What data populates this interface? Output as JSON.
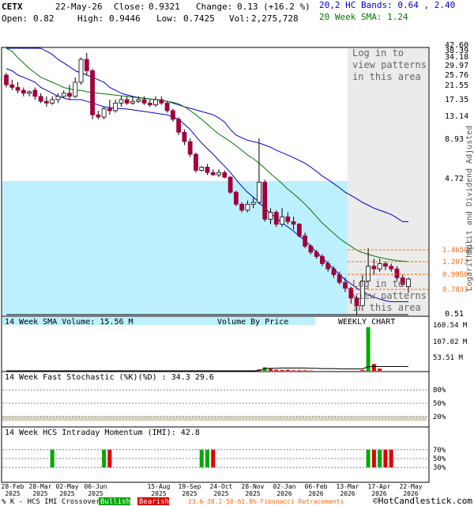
{
  "header": {
    "ticker": "CETX",
    "date": "22-May-26",
    "close_label": "Close:",
    "close": "0.9321",
    "change_label": "Change:",
    "change": "0.13 (+16.2 %)",
    "open_label": "Open:",
    "open": "0.82",
    "high_label": "High:",
    "high": "0.9446",
    "low_label": "Low:",
    "low": "0.7425",
    "vol_label": "Vol:",
    "vol": "2,275,728",
    "hc_bands": "20,2 HC Bands: 0.64 , 2.40",
    "sma_label": "20 Week SMA: 1.24"
  },
  "side_labels": {
    "split": "Split and Dividend Adjusted",
    "log": "Logarithmic"
  },
  "overlays": {
    "login_top": [
      "Log in to",
      "view patterns",
      "in this area"
    ],
    "login_bottom": [
      "Log in to",
      "view patterns",
      "in this area"
    ]
  },
  "panel_titles": {
    "volume": "14 Week SMA Volume: 15.56 M",
    "vbp": "Volume By Price",
    "weekly": "WEEKLY CHART",
    "stoch": "14 Week Fast Stochastic (%K)(%D) : 34.3  29.6",
    "imi": "14 Week HCS Intraday Momentum (IMI): 42.8"
  },
  "footer": {
    "legend_prefix": "% K - HCS IMI Crossover:",
    "bullish": "Bullish",
    "bearish": "Bearish",
    "fib": "23.6-38.2-50-61.8% Fibonacci Retracements",
    "credit": "©HotCandlestick.com"
  },
  "colors": {
    "up": "#ffffff",
    "down": "#a0003c",
    "bands": "#0000cc",
    "sma": "#007700",
    "vbp": "#bdf0ff",
    "login_bg": "#e8e8e8",
    "fib": "#ff6600",
    "vol_bar": "#dd0000",
    "vol_bull": "#00aa00",
    "stoch_k": "#aa0000",
    "stoch_d": "#000000",
    "bull": "#00aa00",
    "bear": "#dd0000",
    "axis_text": "#000080"
  },
  "chart_data": {
    "type": "candlestick",
    "scale": "log",
    "ylim": [
      0.51,
      42.6
    ],
    "price_ticks": [
      "42.60",
      "38.39",
      "34.18",
      "29.97",
      "25.76",
      "21.55",
      "17.35",
      "13.14",
      "8.93",
      "4.72",
      "0.51"
    ],
    "fib_levels": [
      "1.4650",
      "1.2073",
      "0.9950",
      "0.7833"
    ],
    "x_labels": [
      [
        "28-Feb",
        "2025"
      ],
      [
        "28-Mar",
        "2025"
      ],
      [
        "02-May",
        "2025"
      ],
      [
        "06-Jun",
        "2025"
      ],
      [
        "15-Aug",
        "2025"
      ],
      [
        "19-Sep",
        "2025"
      ],
      [
        "24-Oct",
        "2025"
      ],
      [
        "28-Nov",
        "2025"
      ],
      [
        "02-Jan",
        "2026"
      ],
      [
        "06-Feb",
        "2026"
      ],
      [
        "13-Mar",
        "2026"
      ],
      [
        "17-Apr",
        "2026"
      ],
      [
        "22-May",
        "2026"
      ]
    ],
    "candles": [
      [
        27,
        23,
        28,
        22
      ],
      [
        23,
        22,
        25,
        21
      ],
      [
        22,
        21,
        24,
        20
      ],
      [
        21,
        20,
        22,
        19
      ],
      [
        20,
        20.5,
        21,
        19
      ],
      [
        21,
        19,
        22,
        18
      ],
      [
        19,
        17.5,
        20,
        17
      ],
      [
        17.5,
        17,
        19,
        16
      ],
      [
        17,
        18,
        19,
        16.5
      ],
      [
        18,
        19,
        20,
        17
      ],
      [
        19,
        20,
        21,
        18.5
      ],
      [
        20,
        19,
        23,
        18
      ],
      [
        19,
        24,
        26,
        18.5
      ],
      [
        24,
        35,
        36,
        23
      ],
      [
        35,
        29,
        39,
        27
      ],
      [
        29,
        14,
        30,
        13
      ],
      [
        14,
        13.5,
        15,
        13
      ],
      [
        13.5,
        15.5,
        16,
        13
      ],
      [
        15.5,
        15,
        18,
        14
      ],
      [
        15,
        17,
        18,
        14.5
      ],
      [
        17,
        18,
        19,
        16
      ],
      [
        18,
        17,
        19,
        16.5
      ],
      [
        17,
        17.5,
        19,
        16.5
      ],
      [
        17.5,
        18,
        19,
        17
      ],
      [
        18,
        17,
        19,
        16.5
      ],
      [
        17,
        16.5,
        18,
        16
      ],
      [
        16.5,
        18,
        19,
        16
      ],
      [
        18,
        17,
        19,
        16.5
      ],
      [
        17,
        15,
        17.5,
        14.5
      ],
      [
        15,
        13,
        15.5,
        12.5
      ],
      [
        13,
        10.5,
        13.5,
        10
      ],
      [
        10.5,
        9,
        11,
        8.5
      ],
      [
        9,
        7.3,
        9.5,
        7
      ],
      [
        7.3,
        5.6,
        7.5,
        5.4
      ],
      [
        5.6,
        5.9,
        6,
        5.5
      ],
      [
        5.9,
        5.4,
        6.2,
        5.2
      ],
      [
        5.4,
        5.2,
        5.7,
        5.1
      ],
      [
        5.2,
        5.4,
        5.7,
        5
      ],
      [
        5.4,
        5,
        5.6,
        4.9
      ],
      [
        5,
        3.9,
        5.1,
        3.8
      ],
      [
        3.9,
        3.2,
        4,
        3.1
      ],
      [
        3.2,
        2.9,
        3.3,
        2.8
      ],
      [
        2.9,
        3.2,
        3.4,
        2.8
      ],
      [
        3.2,
        3.3,
        3.6,
        3
      ],
      [
        3.3,
        4.6,
        9.5,
        3.2
      ],
      [
        4.6,
        2.5,
        4.8,
        2.4
      ],
      [
        2.5,
        2.8,
        3,
        2.3
      ],
      [
        2.8,
        2.3,
        2.9,
        2.2
      ],
      [
        2.3,
        2.6,
        3,
        2.2
      ],
      [
        2.6,
        2.4,
        2.8,
        2.3
      ],
      [
        2.4,
        2.3,
        2.6,
        2.1
      ],
      [
        2.3,
        1.9,
        2.35,
        1.85
      ],
      [
        1.9,
        1.6,
        2,
        1.55
      ],
      [
        1.6,
        1.45,
        1.65,
        1.4
      ],
      [
        1.45,
        1.35,
        1.5,
        1.3
      ],
      [
        1.35,
        1.2,
        1.4,
        1.15
      ],
      [
        1.2,
        1.1,
        1.25,
        1.05
      ],
      [
        1.1,
        1,
        1.15,
        0.95
      ],
      [
        1,
        0.88,
        1.05,
        0.85
      ],
      [
        0.88,
        0.8,
        0.95,
        0.75
      ],
      [
        0.8,
        0.68,
        0.82,
        0.62
      ],
      [
        0.68,
        0.6,
        0.7,
        0.52
      ],
      [
        0.6,
        0.9,
        1.0,
        0.55
      ],
      [
        0.9,
        1.15,
        1.55,
        0.85
      ],
      [
        1.15,
        1.1,
        1.3,
        1.0
      ],
      [
        1.1,
        1.2,
        1.3,
        1.05
      ],
      [
        1.2,
        1.15,
        1.25,
        1.08
      ],
      [
        1.15,
        1.1,
        1.2,
        1.05
      ],
      [
        1.1,
        0.95,
        1.15,
        0.9
      ],
      [
        0.95,
        0.85,
        1.0,
        0.82
      ],
      [
        0.82,
        0.93,
        0.95,
        0.74
      ]
    ],
    "upper_band": [
      50,
      49,
      48,
      47,
      44,
      43,
      42,
      40,
      38,
      35,
      33,
      31,
      29,
      28,
      27,
      26,
      25,
      24,
      22,
      21,
      20,
      19.5,
      19,
      18.6,
      18.4,
      18.2,
      18,
      17.8,
      17.5,
      17,
      16.5,
      16,
      15.6,
      15.2,
      14.8,
      14.4,
      14,
      13.3,
      12.4,
      11,
      10,
      9.6,
      9.2,
      9,
      8.8,
      8.5,
      8.2,
      7.8,
      7.5,
      7.2,
      6.9,
      6.6,
      6.3,
      5.9,
      5.5,
      5.1,
      4.8,
      4.5,
      4.2,
      3.9,
      3.7,
      3.5,
      3.3,
      3.15,
      3.0,
      2.9,
      2.8,
      2.7,
      2.55,
      2.4,
      2.4
    ],
    "lower_band": [
      30,
      29,
      27,
      26,
      25,
      24,
      22,
      21,
      20,
      19,
      18.5,
      18,
      18,
      18,
      17.5,
      17,
      16.5,
      16,
      15.8,
      15.6,
      15.5,
      15.4,
      15.2,
      15,
      14.8,
      14.6,
      14.4,
      14.2,
      14,
      13.5,
      13,
      12,
      11,
      9.8,
      8.8,
      8,
      7.3,
      6.6,
      6,
      5.4,
      4.8,
      4.3,
      3.9,
      3.6,
      3.3,
      3.0,
      2.75,
      2.55,
      2.35,
      2.2,
      2.05,
      1.9,
      1.75,
      1.6,
      1.45,
      1.32,
      1.2,
      1.1,
      1.0,
      0.92,
      0.86,
      0.8,
      0.76,
      0.72,
      0.69,
      0.67,
      0.65,
      0.64,
      0.64,
      0.64,
      0.64
    ],
    "sma20": [
      44,
      40,
      36,
      33,
      30,
      28,
      26,
      25,
      24,
      23,
      22,
      21.5,
      21,
      21,
      20.5,
      20.2,
      20,
      19.8,
      19.6,
      19.4,
      19.2,
      19,
      18.8,
      18.6,
      18.4,
      18.2,
      18,
      17.8,
      17.5,
      17.2,
      16.8,
      16,
      15,
      14,
      13,
      12,
      11,
      10.2,
      9.6,
      9,
      8.4,
      7.8,
      7.2,
      6.8,
      6.3,
      5.8,
      5.3,
      4.9,
      4.5,
      4.1,
      3.8,
      3.5,
      3.2,
      2.9,
      2.6,
      2.35,
      2.15,
      1.98,
      1.82,
      1.7,
      1.6,
      1.5,
      1.44,
      1.4,
      1.36,
      1.33,
      1.3,
      1.28,
      1.26,
      1.25,
      1.24
    ],
    "volume": {
      "ticks": [
        "160.54 M",
        "107.02 M",
        "53.51 M"
      ],
      "bars": [
        44,
        5,
        45,
        13,
        46,
        8,
        47,
        4,
        48,
        3,
        49,
        4,
        50,
        2,
        51,
        2,
        52,
        2,
        53,
        1,
        62,
        3,
        63,
        160,
        64,
        25,
        65,
        8
      ],
      "bull_index": [
        45,
        63
      ],
      "sma_line": [
        0,
        0,
        0,
        0,
        0,
        0,
        0,
        0,
        0,
        0,
        0,
        0,
        0,
        0,
        0,
        0,
        0,
        0,
        0,
        0,
        0,
        0,
        0,
        0,
        0,
        0,
        0,
        0,
        0,
        0,
        0,
        0,
        0,
        0,
        0,
        0,
        0,
        0,
        0,
        0,
        0,
        0,
        0,
        0,
        1,
        8,
        9,
        9,
        10,
        10,
        10,
        10,
        10,
        9,
        9,
        8,
        8,
        8,
        7,
        7,
        7,
        7,
        7,
        15,
        16,
        16,
        16,
        16,
        16,
        16,
        15.6
      ]
    },
    "stoch": {
      "ticks": [
        "80%",
        "50%",
        "20%"
      ],
      "k": [
        20,
        18,
        15,
        15,
        20,
        22,
        25,
        30,
        35,
        40,
        45,
        50,
        55,
        65,
        85,
        30,
        15,
        12,
        10,
        14,
        18,
        22,
        26,
        24,
        22,
        24,
        26,
        22,
        18,
        14,
        10,
        8,
        7,
        6,
        8,
        10,
        12,
        14,
        16,
        12,
        10,
        9,
        10,
        12,
        16,
        22,
        14,
        10,
        9,
        8,
        9,
        8,
        7,
        6,
        5,
        5,
        4,
        4,
        3,
        3,
        3,
        4,
        8,
        22,
        30,
        28,
        26,
        24,
        22,
        20,
        34.3
      ],
      "d": [
        18,
        17,
        16,
        15,
        17,
        19,
        22,
        26,
        30,
        35,
        40,
        45,
        50,
        55,
        68,
        55,
        40,
        20,
        12,
        12,
        14,
        18,
        22,
        24,
        23,
        23,
        24,
        24,
        22,
        18,
        14,
        10,
        8,
        7,
        7,
        8,
        10,
        12,
        14,
        14,
        12,
        10,
        9,
        10,
        12,
        16,
        17,
        15,
        11,
        9,
        9,
        8,
        8,
        7,
        6,
        5,
        5,
        4,
        4,
        3,
        3,
        3,
        5,
        11,
        20,
        27,
        28,
        26,
        24,
        22,
        29.6
      ]
    },
    "imi": {
      "ticks": [
        "70%",
        "50%",
        "30%"
      ],
      "line": [
        35,
        34,
        33,
        32,
        35,
        38,
        40,
        38,
        36,
        35,
        40,
        45,
        50,
        55,
        60,
        40,
        35,
        30,
        32,
        35,
        38,
        40,
        42,
        40,
        38,
        40,
        45,
        42,
        38,
        35,
        32,
        30,
        30,
        32,
        34,
        33,
        32,
        33,
        34,
        32,
        30,
        31,
        33,
        35,
        40,
        38,
        35,
        33,
        34,
        33,
        32,
        31,
        30,
        29,
        28,
        28,
        27,
        27,
        26,
        26,
        27,
        30,
        36,
        45,
        50,
        48,
        46,
        44,
        42,
        40,
        42.8
      ],
      "signals": [
        [
          8,
          "bull"
        ],
        [
          17,
          "bull"
        ],
        [
          18,
          "bear"
        ],
        [
          34,
          "bull"
        ],
        [
          35,
          "bull"
        ],
        [
          36,
          "bear"
        ],
        [
          63,
          "bull"
        ],
        [
          64,
          "bear"
        ],
        [
          65,
          "bull"
        ],
        [
          66,
          "bear"
        ],
        [
          67,
          "bear"
        ]
      ]
    }
  }
}
